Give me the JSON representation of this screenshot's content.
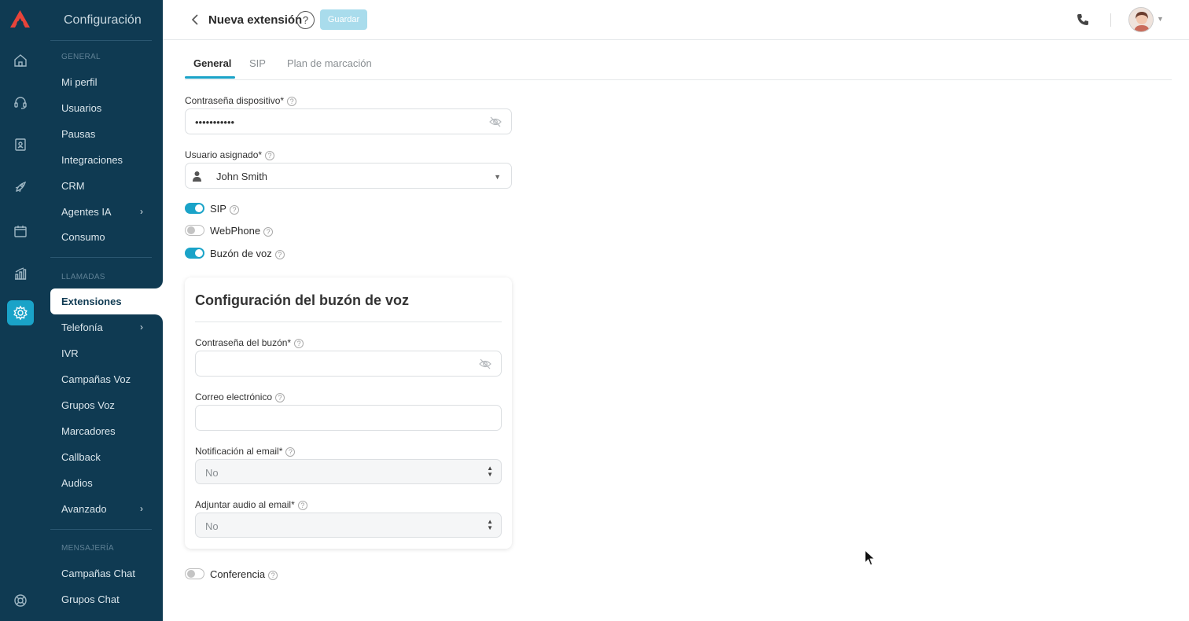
{
  "colors": {
    "sidebar_bg": "#0f3a52",
    "accent": "#1aa3c8",
    "save_disabled": "#a9dcec"
  },
  "rail": {
    "icons": [
      "logo-icon",
      "home-icon",
      "headset-icon",
      "contact-book-icon",
      "rocket-icon",
      "calendar-icon",
      "analytics-icon",
      "settings-icon",
      "support-icon"
    ]
  },
  "sidebar": {
    "title": "Configuración",
    "sections": [
      {
        "label": "GENERAL",
        "items": [
          "Mi perfil",
          "Usuarios",
          "Pausas",
          "Integraciones",
          "CRM",
          "Agentes IA",
          "Consumo"
        ]
      },
      {
        "label": "LLAMADAS",
        "items": [
          "Extensiones",
          "Telefonía",
          "IVR",
          "Campañas Voz",
          "Grupos Voz",
          "Marcadores",
          "Callback",
          "Audios",
          "Avanzado"
        ]
      },
      {
        "label": "MENSAJERÍA",
        "items": [
          "Campañas Chat",
          "Grupos Chat"
        ]
      }
    ],
    "active_item": "Extensiones"
  },
  "header": {
    "title": "Nueva extensión",
    "help": "?",
    "save_label": "Guardar"
  },
  "tabs": [
    {
      "label": "General",
      "active": true
    },
    {
      "label": "SIP",
      "active": false
    },
    {
      "label": "Plan de marcación",
      "active": false
    }
  ],
  "form": {
    "device_password_label": "Contraseña dispositivo*",
    "device_password_value": "•••••••••••",
    "assigned_user_label": "Usuario asignado*",
    "assigned_user_value": "John Smith",
    "toggles": [
      {
        "label": "SIP",
        "on": true
      },
      {
        "label": "WebPhone",
        "on": false
      },
      {
        "label": "Buzón de voz",
        "on": true
      }
    ],
    "voicemail": {
      "title": "Configuración del buzón de voz",
      "password_label": "Contraseña del buzón*",
      "password_value": "",
      "email_label": "Correo electrónico",
      "email_value": "",
      "notify_label": "Notificación al email*",
      "notify_value": "No",
      "attach_label": "Adjuntar audio al email*",
      "attach_value": "No"
    },
    "conference_label": "Conferencia",
    "conference_on": false
  }
}
